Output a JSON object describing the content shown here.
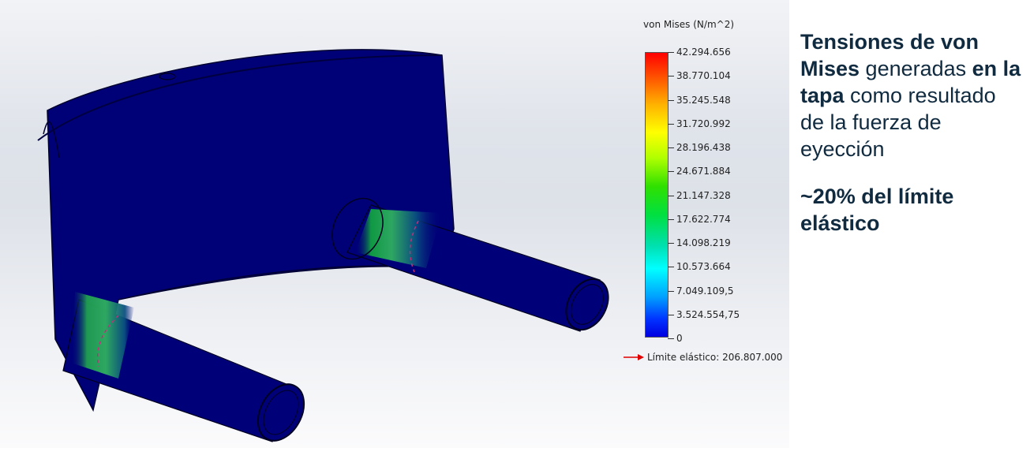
{
  "legend": {
    "title": "von Mises (N/m^2)",
    "ticks": [
      "42.294.656",
      "38.770.104",
      "35.245.548",
      "31.720.992",
      "28.196.438",
      "24.671.884",
      "21.147.328",
      "17.622.774",
      "14.098.219",
      "10.573.664",
      "7.049.109,5",
      "3.524.554,75",
      "0"
    ],
    "yield_label": "Límite elástico: 206.807.000",
    "colors": {
      "max": "#ff0000",
      "min": "#0000e0",
      "part": "#000078",
      "yield_arrow": "#e00000"
    }
  },
  "description": {
    "part1_bold": "Tensiones de von Mises",
    "part2": " generadas ",
    "part3_bold": "en la tapa",
    "part4": " como resultado de la fuerza de eyección",
    "summary": "~20% del límite elástico"
  }
}
